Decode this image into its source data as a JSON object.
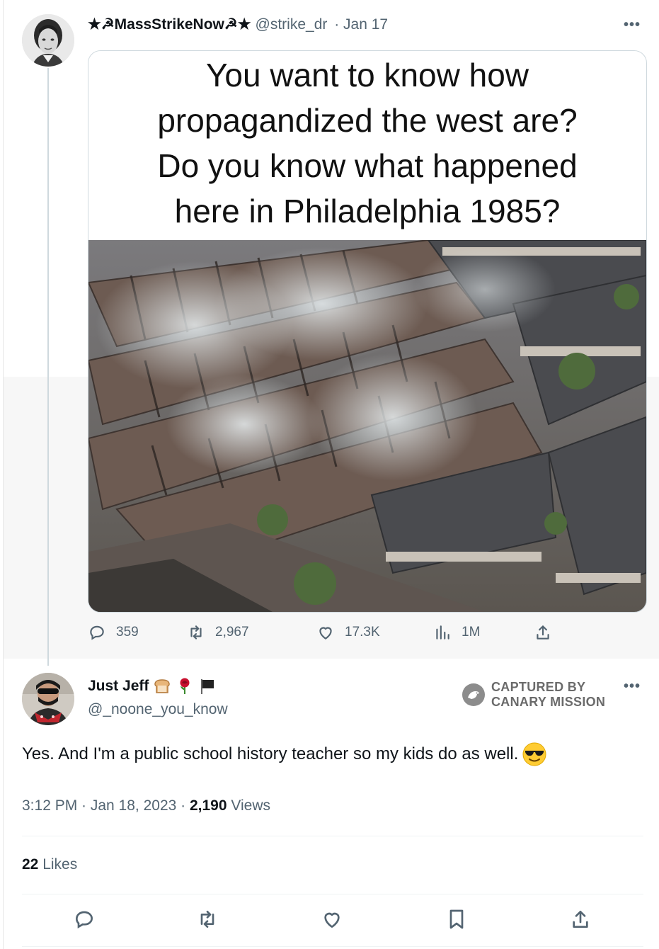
{
  "parent_tweet": {
    "display_name": "★☭MassStrikeNow☭★",
    "handle": "@strike_dr",
    "date": "· Jan 17",
    "image_text_lines": [
      "You want to know how",
      "propagandized the west are?",
      "Do you know what happened",
      "here in Philadelphia 1985?"
    ],
    "image_description_icon": "aerial-photo-burned-rowhouses",
    "metrics": {
      "replies": "359",
      "retweets": "2,967",
      "likes": "17.3K",
      "views": "1M"
    }
  },
  "reply_tweet": {
    "display_name": "Just Jeff",
    "name_emojis": [
      "bread-icon",
      "rose-icon",
      "black-flag-icon"
    ],
    "handle": "@_noone_you_know",
    "watermark_line1": "CAPTURED BY",
    "watermark_line2": "CANARY MISSION",
    "text": "Yes. And I'm a public school history teacher so my kids do as well.",
    "text_emoji": "sunglasses-face-icon",
    "time": "3:12 PM · Jan 18, 2023 ·",
    "views_count": "2,190",
    "views_label": "Views",
    "likes_count": "22",
    "likes_label": "Likes"
  },
  "colors": {
    "text_primary": "#0f1419",
    "text_secondary": "#536471",
    "border": "#cfd9de"
  }
}
